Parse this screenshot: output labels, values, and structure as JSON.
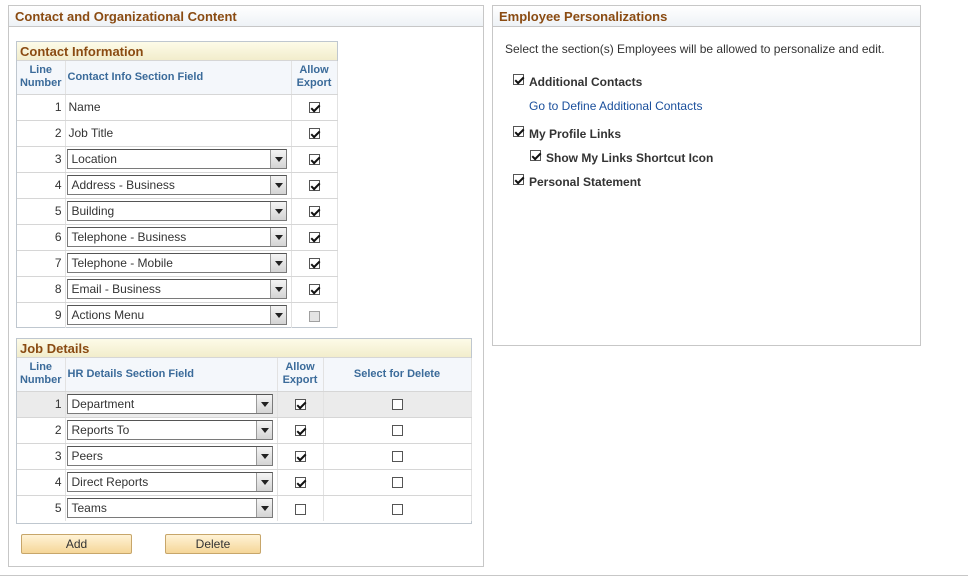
{
  "left_group": {
    "title": "Contact and Organizational Content",
    "contact": {
      "title": "Contact Information",
      "col_line": "Line Number",
      "col_field": "Contact Info Section Field",
      "col_export": "Allow Export",
      "rows": [
        {
          "line": "1",
          "field": "Name",
          "type": "text",
          "export": true
        },
        {
          "line": "2",
          "field": "Job Title",
          "type": "text",
          "export": true
        },
        {
          "line": "3",
          "field": "Location",
          "type": "select",
          "export": true
        },
        {
          "line": "4",
          "field": "Address - Business",
          "type": "select",
          "export": true
        },
        {
          "line": "5",
          "field": "Building",
          "type": "select",
          "export": true
        },
        {
          "line": "6",
          "field": "Telephone - Business",
          "type": "select",
          "export": true
        },
        {
          "line": "7",
          "field": "Telephone - Mobile",
          "type": "select",
          "export": true
        },
        {
          "line": "8",
          "field": "Email - Business",
          "type": "select",
          "export": true
        },
        {
          "line": "9",
          "field": "Actions Menu",
          "type": "select",
          "export": false,
          "export_disabled": true
        }
      ]
    },
    "job": {
      "title": "Job Details",
      "col_line": "Line Number",
      "col_field": "HR Details Section Field",
      "col_export": "Allow Export",
      "col_delete": "Select for Delete",
      "rows": [
        {
          "line": "1",
          "field": "Department",
          "export": true,
          "delete": false,
          "selected": true
        },
        {
          "line": "2",
          "field": "Reports To",
          "export": true,
          "delete": false
        },
        {
          "line": "3",
          "field": "Peers",
          "export": true,
          "delete": false
        },
        {
          "line": "4",
          "field": "Direct Reports",
          "export": true,
          "delete": false
        },
        {
          "line": "5",
          "field": "Teams",
          "export": false,
          "delete": false
        }
      ]
    },
    "add_label": "Add",
    "delete_label": "Delete"
  },
  "right_group": {
    "title": "Employee Personalizations",
    "instructions": "Select the section(s) Employees will be allowed to personalize and edit.",
    "additional_contacts": {
      "label": "Additional Contacts",
      "checked": true
    },
    "define_link": "Go to Define Additional Contacts",
    "profile_links": {
      "label": "My Profile Links",
      "checked": true
    },
    "shortcut_icon": {
      "label": "Show My Links Shortcut Icon",
      "checked": true
    },
    "personal_statement": {
      "label": "Personal Statement",
      "checked": true
    }
  }
}
